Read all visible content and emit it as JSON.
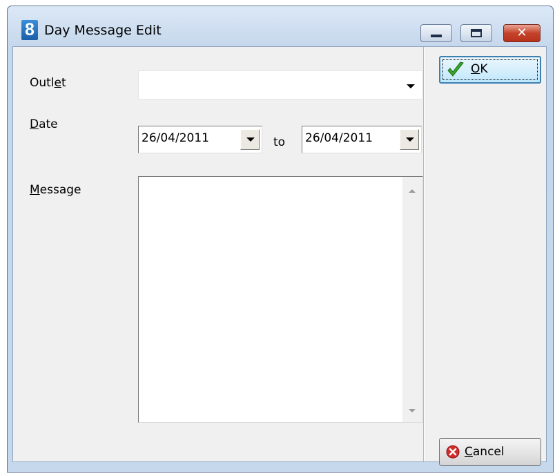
{
  "window": {
    "title": "Day Message Edit",
    "app_icon_glyph": "8",
    "caption": {
      "minimize": "minimize-icon",
      "maximize": "maximize-icon",
      "close_glyph": "✕"
    }
  },
  "form": {
    "outlet": {
      "label_pre": "Outl",
      "label_key": "e",
      "label_post": "t",
      "value": ""
    },
    "date": {
      "label_key": "D",
      "label_post": "ate",
      "from_value": "26/04/2011",
      "to_label": "to",
      "to_value": "26/04/2011"
    },
    "message": {
      "label_key": "M",
      "label_post": "essage",
      "value": ""
    }
  },
  "buttons": {
    "ok": {
      "label_key": "O",
      "label_post": "K",
      "icon": "checkmark-icon"
    },
    "cancel": {
      "label_key": "C",
      "label_post": "ancel",
      "icon": "cancel-icon"
    }
  },
  "colors": {
    "titlebar": "#c5d7ec",
    "client": "#f0f0f0",
    "close_button": "#c5432b",
    "ok_check": "#3aa62a",
    "cancel_icon": "#d22b2b"
  }
}
